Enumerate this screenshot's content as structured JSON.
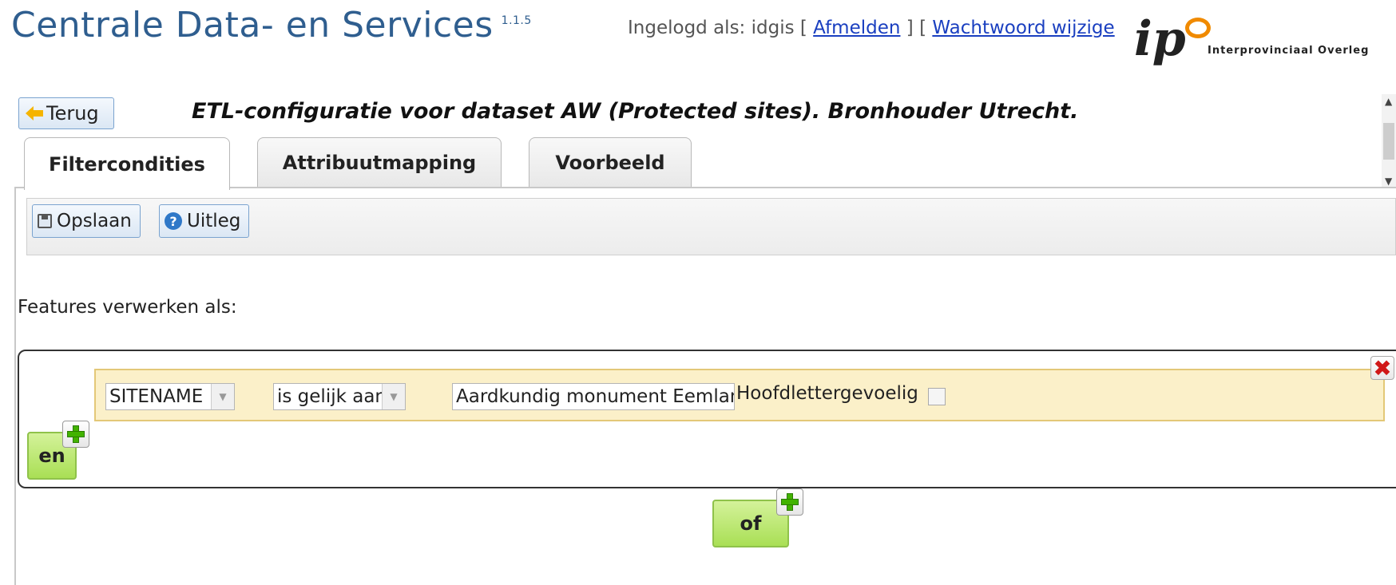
{
  "header": {
    "app_title": "Centrale Data- en Services",
    "version": "1.1.5",
    "login_prefix": "Ingelogd als: idgis [ ",
    "logout_link": "Afmelden",
    "separator": " ] [ ",
    "change_password_link": "Wachtwoord wijzige",
    "logo_text": "ip",
    "logo_org": "Interprovinciaal Overleg"
  },
  "page": {
    "back_label": "Terug",
    "title": "ETL-configuratie voor dataset AW (Protected sites). Bronhouder Utrecht."
  },
  "tabs": [
    {
      "label": "Filtercondities",
      "active": true
    },
    {
      "label": "Attribuutmapping",
      "active": false
    },
    {
      "label": "Voorbeeld",
      "active": false
    }
  ],
  "toolbar": {
    "save_label": "Opslaan",
    "help_label": "Uitleg"
  },
  "filter": {
    "features_label": "Features verwerken als:",
    "condition": {
      "attribute": "SITENAME",
      "operator": "is gelijk aan",
      "value": "Aardkundig monument Eemland",
      "case_label": "Hoofdlettergevoelig",
      "case_checked": false
    },
    "and_label": "en",
    "or_label": "of"
  },
  "colors": {
    "title_blue": "#2f5e8f",
    "link_blue": "#1a3fc0",
    "logic_green": "#a9df55",
    "condition_bg": "#fbf0c9",
    "delete_red": "#d01818"
  },
  "icons": {
    "back": "back-arrow-icon",
    "save": "floppy-disk-icon",
    "help": "help-icon",
    "delete": "close-icon",
    "add": "plus-icon"
  }
}
